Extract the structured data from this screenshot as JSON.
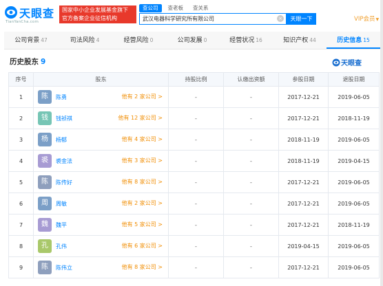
{
  "header": {
    "logo_text": "天眼查",
    "logo_sub": "TianYanCha.com",
    "banner_line1": "国家中小企业发展基金旗下",
    "banner_line2": "官方备案企业征信机构",
    "search_tabs": [
      "查公司",
      "查老板",
      "查关系"
    ],
    "search_value": "武汉电器科学研究所有限公司",
    "search_button": "天眼一下",
    "vip_label": "VIP会员",
    "clear_icon": "×"
  },
  "nav": [
    {
      "label": "公司背景",
      "count": "47"
    },
    {
      "label": "司法风险",
      "count": "4"
    },
    {
      "label": "经营风险",
      "count": "0"
    },
    {
      "label": "公司发展",
      "count": "0"
    },
    {
      "label": "经营状况",
      "count": "16"
    },
    {
      "label": "知识产权",
      "count": "44"
    },
    {
      "label": "历史信息",
      "count": "15"
    }
  ],
  "section": {
    "title": "历史股东",
    "count": "9",
    "logo_text": "天眼查"
  },
  "table": {
    "headers": [
      "序号",
      "股东",
      "持股比例",
      "认缴出资额",
      "参股日期",
      "退股日期"
    ],
    "rows": [
      {
        "no": "1",
        "avatar": "陈",
        "avatar_color": "#7b9fc7",
        "name": "陈勇",
        "link": "他有 2 家公司 >",
        "ratio": "-",
        "capital": "-",
        "join": "2017-12-21",
        "exit": "2019-06-05"
      },
      {
        "no": "2",
        "avatar": "钱",
        "avatar_color": "#76c5b5",
        "name": "钱祯祺",
        "link": "他有 12 家公司 >",
        "ratio": "-",
        "capital": "-",
        "join": "2017-12-21",
        "exit": "2018-11-19"
      },
      {
        "no": "3",
        "avatar": "杨",
        "avatar_color": "#7b9fc7",
        "name": "杨郁",
        "link": "他有 4 家公司 >",
        "ratio": "-",
        "capital": "-",
        "join": "2018-11-19",
        "exit": "2019-06-05"
      },
      {
        "no": "4",
        "avatar": "裘",
        "avatar_color": "#a79bd3",
        "name": "裘金法",
        "link": "他有 3 家公司 >",
        "ratio": "-",
        "capital": "-",
        "join": "2018-11-19",
        "exit": "2019-04-15"
      },
      {
        "no": "5",
        "avatar": "陈",
        "avatar_color": "#8e9fbd",
        "name": "陈传好",
        "link": "他有 8 家公司 >",
        "ratio": "-",
        "capital": "-",
        "join": "2017-12-21",
        "exit": "2019-06-05"
      },
      {
        "no": "6",
        "avatar": "周",
        "avatar_color": "#7b9fc7",
        "name": "周敏",
        "link": "他有 2 家公司 >",
        "ratio": "-",
        "capital": "-",
        "join": "2017-12-21",
        "exit": "2019-06-05"
      },
      {
        "no": "7",
        "avatar": "魏",
        "avatar_color": "#a79bd3",
        "name": "魏平",
        "link": "他有 5 家公司 >",
        "ratio": "-",
        "capital": "-",
        "join": "2017-12-21",
        "exit": "2018-11-19"
      },
      {
        "no": "8",
        "avatar": "孔",
        "avatar_color": "#a9c86a",
        "name": "孔伟",
        "link": "他有 6 家公司 >",
        "ratio": "-",
        "capital": "-",
        "join": "2019-04-15",
        "exit": "2019-06-05"
      },
      {
        "no": "9",
        "avatar": "陈",
        "avatar_color": "#8e9fbd",
        "name": "陈伟立",
        "link": "他有 8 家公司 >",
        "ratio": "-",
        "capital": "-",
        "join": "2017-12-21",
        "exit": "2019-06-05"
      }
    ]
  },
  "colors": {
    "brand": "#0084ff",
    "banner": "#e8392b",
    "link_orange": "#f08c00"
  }
}
